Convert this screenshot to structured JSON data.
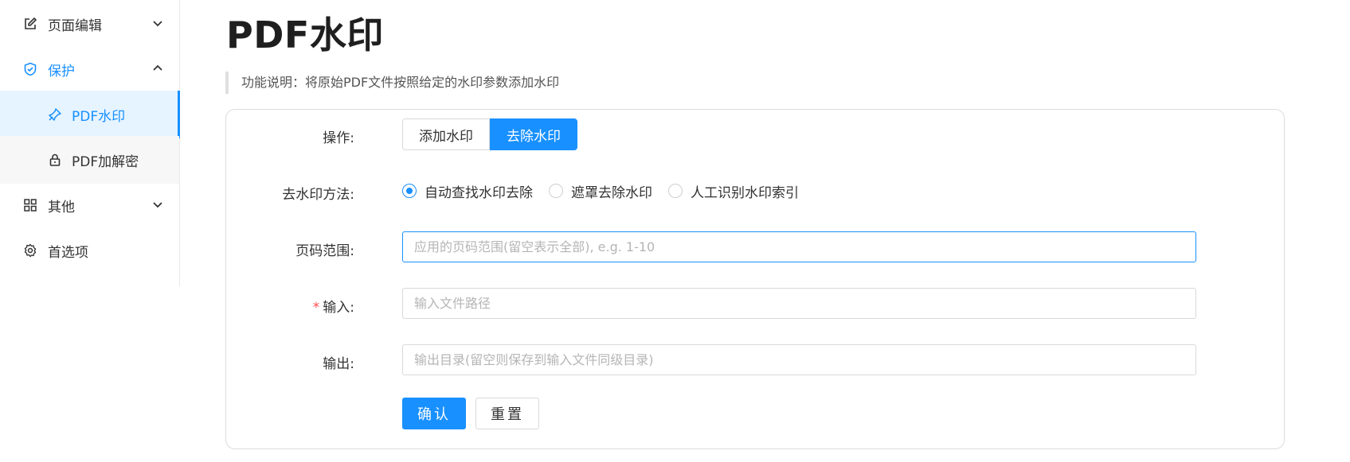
{
  "sidebar": {
    "items": [
      {
        "label": "页面编辑",
        "icon": "edit-icon",
        "arrow": "chevron-down-icon"
      },
      {
        "label": "保护",
        "icon": "shield-icon",
        "arrow": "chevron-up-icon"
      },
      {
        "label": "PDF水印",
        "icon": "stamp-icon"
      },
      {
        "label": "PDF加解密",
        "icon": "lock-icon"
      },
      {
        "label": "其他",
        "icon": "grid-icon",
        "arrow": "chevron-down-icon"
      },
      {
        "label": "首选项",
        "icon": "gear-icon"
      }
    ]
  },
  "main": {
    "title": "PDF水印",
    "description": "功能说明：将原始PDF文件按照给定的水印参数添加水印",
    "form": {
      "operation": {
        "label": "操作:",
        "options": [
          "添加水印",
          "去除水印"
        ],
        "selected": "去除水印"
      },
      "method": {
        "label": "去水印方法:",
        "options": [
          "自动查找水印去除",
          "遮罩去除水印",
          "人工识别水印索引"
        ],
        "selected": "自动查找水印去除"
      },
      "page_range": {
        "label": "页码范围:",
        "value": "",
        "placeholder": "应用的页码范围(留空表示全部), e.g. 1-10"
      },
      "input": {
        "label": "输入:",
        "required_mark": "*",
        "value": "",
        "placeholder": "输入文件路径"
      },
      "output": {
        "label": "输出:",
        "value": "",
        "placeholder": "输出目录(留空则保存到输入文件同级目录)"
      },
      "confirm_label": "确认",
      "reset_label": "重置"
    }
  },
  "colors": {
    "accent": "#1890ff",
    "required": "#ff4d4f"
  }
}
